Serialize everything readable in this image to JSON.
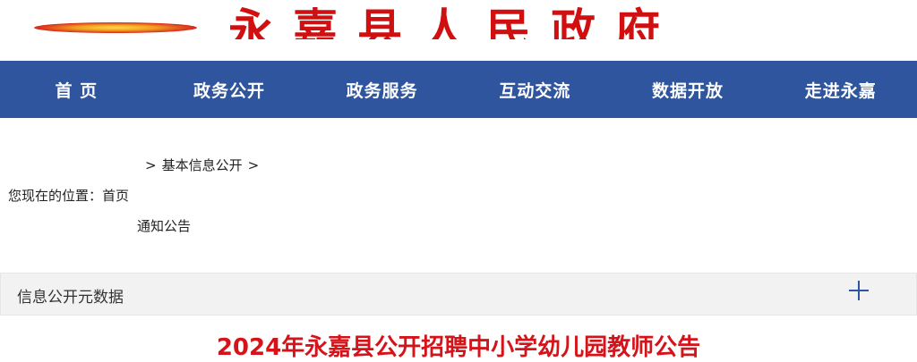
{
  "header": {
    "site_title": "永嘉县人民政府",
    "emblem_icon": "national-emblem-icon"
  },
  "nav": {
    "items": [
      {
        "label": "首 页"
      },
      {
        "label": "政务公开"
      },
      {
        "label": "政务服务"
      },
      {
        "label": "互动交流"
      },
      {
        "label": "数据开放"
      },
      {
        "label": "走进永嘉"
      }
    ],
    "background": "#2e559d"
  },
  "breadcrumb": {
    "sep": ">",
    "prefix": "您现在的位置：",
    "home": "首页",
    "level2": "基本信息公开",
    "level3": "通知公告"
  },
  "metadata": {
    "label": "信息公开元数据",
    "toggle_icon": "plus-icon"
  },
  "article": {
    "title": "2024年永嘉县公开招聘中小学幼儿园教师公告",
    "title_color": "#d4141a"
  }
}
